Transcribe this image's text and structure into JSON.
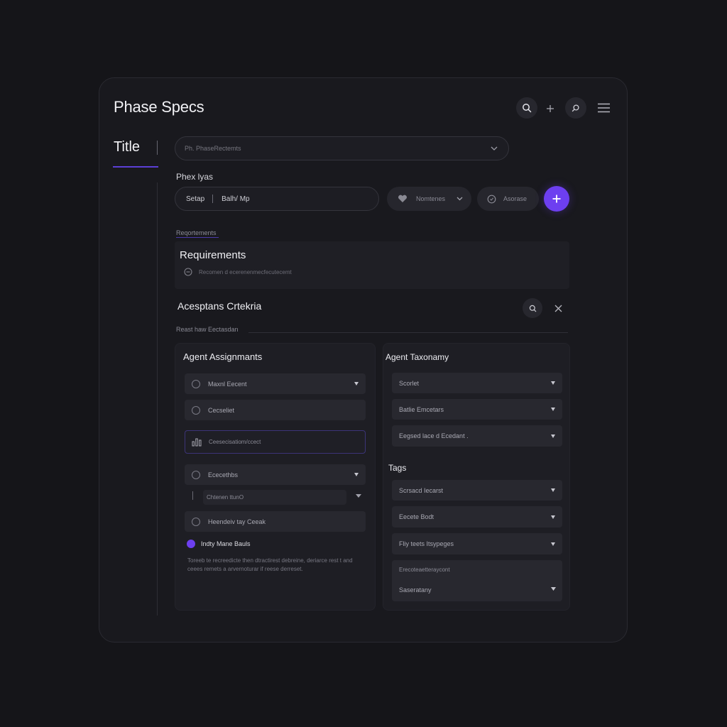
{
  "header": {
    "title": "Phase Specs",
    "icons": [
      "search-icon",
      "plus-icon",
      "zoom-icon",
      "menu-icon"
    ]
  },
  "title_tab": {
    "label": "Title"
  },
  "phase_select": {
    "value": "Ph. PhaseRectemts"
  },
  "phase_types": {
    "label": "Phex lyas",
    "field_left": "Setap",
    "field_right": "Balh/ Mp",
    "pill_one": "Nomtenes",
    "pill_two": "Asorase"
  },
  "requirements": {
    "small_label": "Reqortements",
    "title": "Requirements",
    "detail": "Recomen d ecerenenmecfecutecemt"
  },
  "acceptance": {
    "title": "Acesptans Crtekria",
    "subtitle": "Reast haw Eectasdan"
  },
  "agent_assignments": {
    "title": "Agent Assignmants",
    "rows": [
      {
        "label": "Maxnl Eecent",
        "has_caret": true
      },
      {
        "label": "Cecseliet",
        "has_caret": false
      },
      {
        "label": "Ceesecisatiom/ccect",
        "has_caret": false
      },
      {
        "label": "Ececethbs",
        "has_caret": true
      },
      {
        "label": "Chtenen ttunO",
        "has_caret": true
      },
      {
        "label": "Heendeiv tay Ceeak",
        "has_caret": false
      }
    ],
    "toggle_label": "Indty Mane Bauls",
    "description_line1": "Toreeb te recreedicte then dtractirest debreine, deriarce rest t and",
    "description_line2": "ceees remets a arvernoturar if reese derreset."
  },
  "agent_taxonomy": {
    "title": "Agent Taxonamy",
    "rows": [
      "Scorlet",
      "Batlie Emcetars",
      "Eegsed lace d Ecedant ."
    ]
  },
  "tags": {
    "title": "Tags",
    "rows": [
      "Scrsacd Iecarst",
      "Eecete Bodt",
      "Fliy teets Itsypeges"
    ],
    "combo_label": "Erecoteaetteraycont",
    "combo_value": "Saseratany"
  },
  "colors": {
    "accent": "#6d3ff0",
    "panel": "#19191e",
    "background": "#151519"
  }
}
